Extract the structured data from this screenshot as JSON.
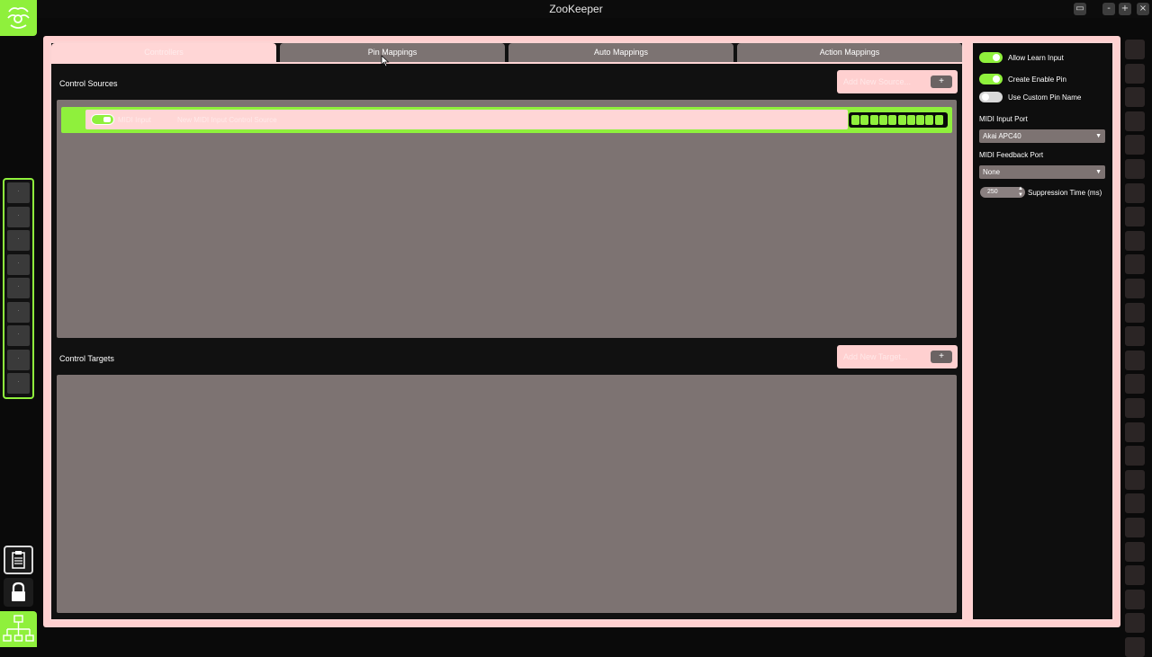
{
  "window": {
    "title": "ZooKeeper",
    "buttons": [
      "-",
      "+",
      "×"
    ]
  },
  "tabs": [
    {
      "label": "Controllers",
      "active": true
    },
    {
      "label": "Pin Mappings",
      "active": false
    },
    {
      "label": "Auto Mappings",
      "active": false
    },
    {
      "label": "Action Mappings",
      "active": false
    }
  ],
  "sources": {
    "title": "Control Sources",
    "add_label": "Add New Source...",
    "add_button": "+",
    "items": [
      {
        "type": "MIDI Input",
        "name": "New MIDI Input Control Source",
        "meter_leds": 10
      }
    ]
  },
  "targets": {
    "title": "Control Targets",
    "add_label": "Add New Target...",
    "add_button": "+"
  },
  "settings": {
    "allow_learn": {
      "label": "Allow Learn Input",
      "on": true
    },
    "create_enable_pin": {
      "label": "Create Enable Pin",
      "on": true
    },
    "custom_pin_name": {
      "label": "Use Custom Pin Name",
      "on": false
    },
    "midi_input_port": {
      "label": "MIDI Input Port",
      "value": "Akai APC40"
    },
    "midi_feedback_port": {
      "label": "MIDI Feedback Port",
      "value": "None"
    },
    "suppression": {
      "value": "250",
      "label": "Suppression Time (ms)"
    }
  },
  "sidebar": {
    "slot_count": 9,
    "slot_glyph": "·"
  },
  "colors": {
    "accent_green": "#8ff03c",
    "frame_pink": "#ffd0d0",
    "panel_grey": "#7d7372"
  }
}
